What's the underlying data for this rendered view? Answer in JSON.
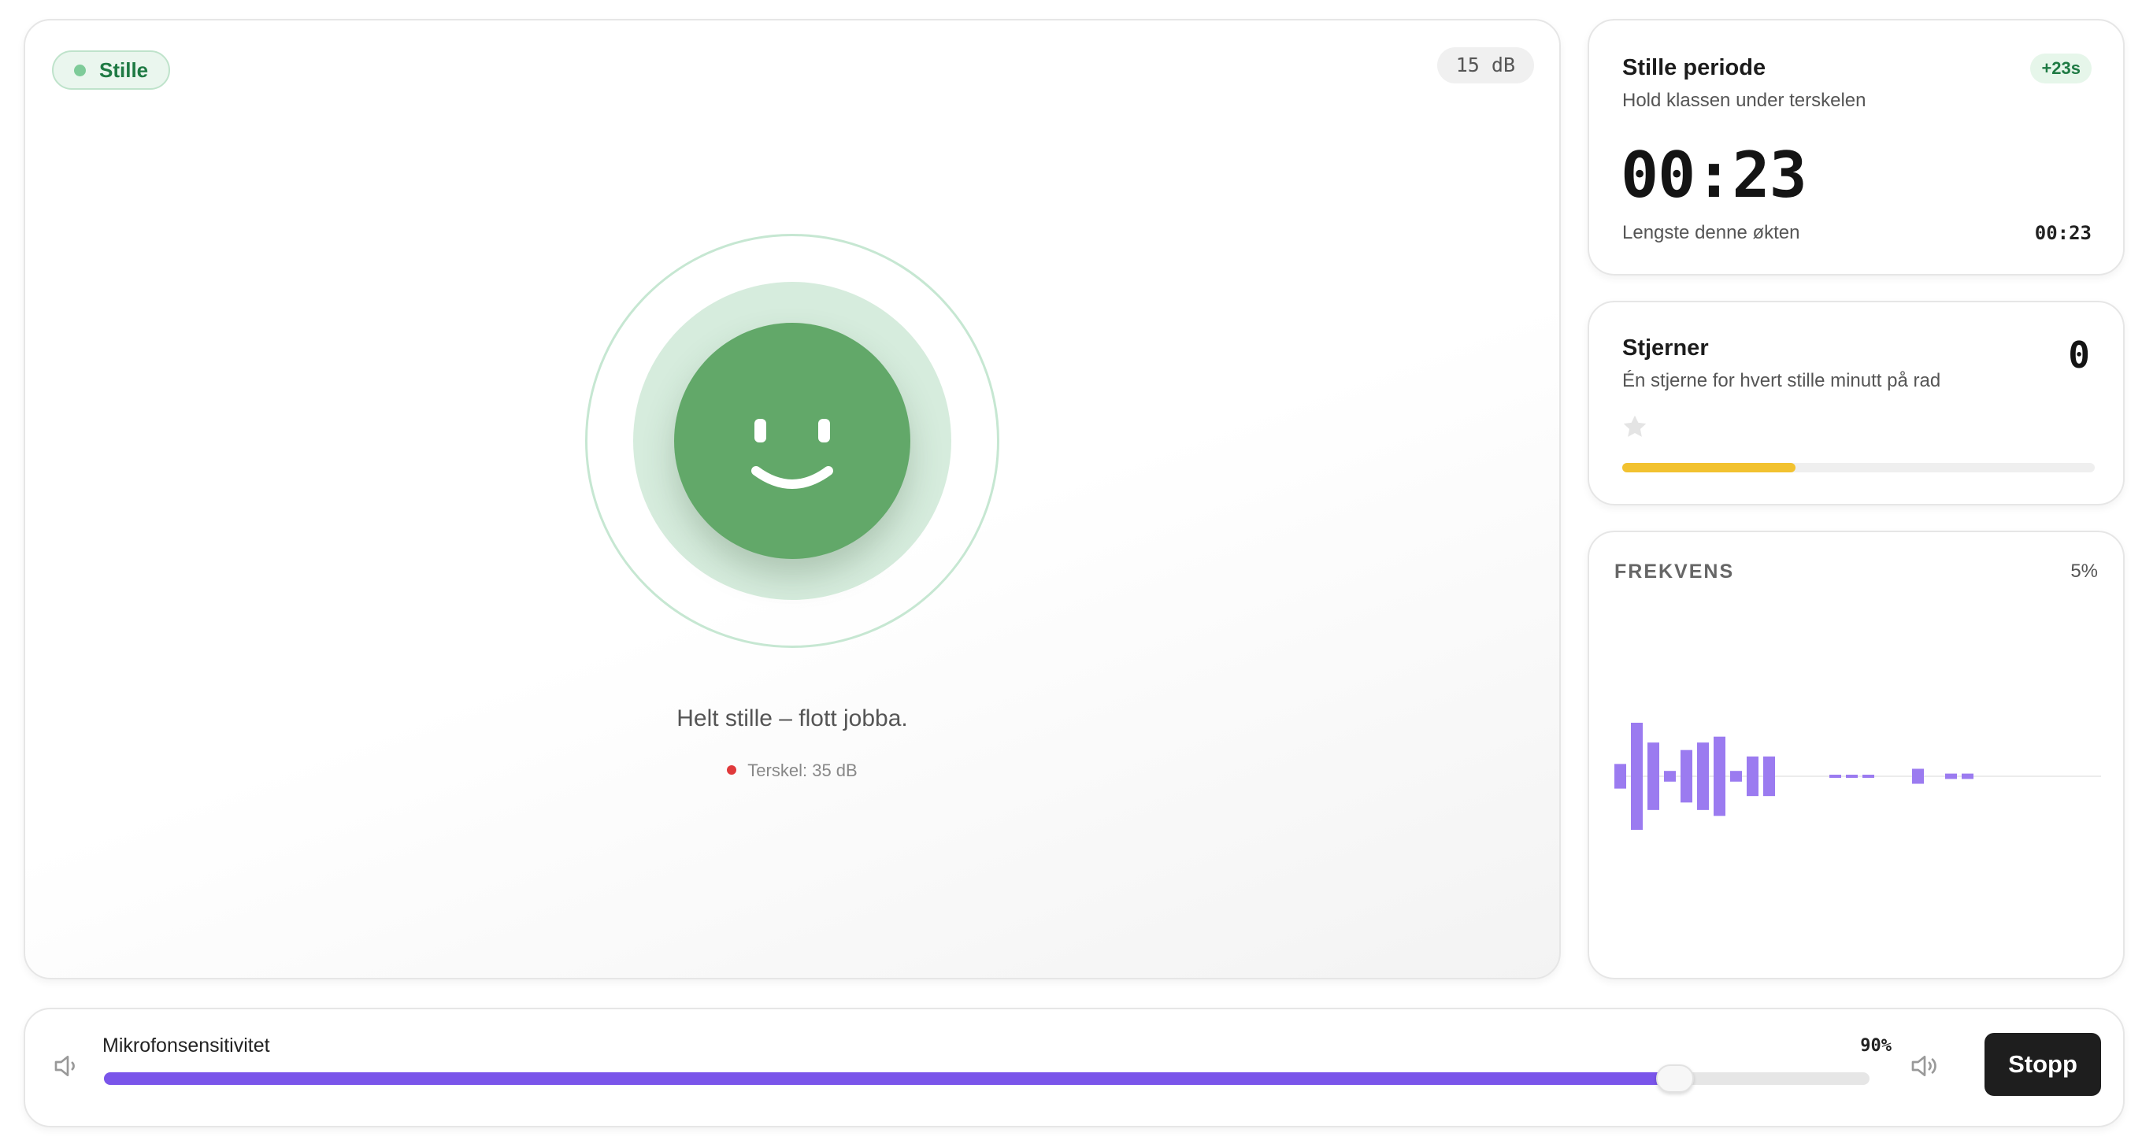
{
  "status": {
    "label": "Stille",
    "dot_color": "#7ecb99"
  },
  "level": {
    "db": "15 dB"
  },
  "face": {
    "mood": "smiley-face",
    "color": "#62a869"
  },
  "message": "Helt stille – flott jobba.",
  "threshold": {
    "label": "Terskel: 35 dB",
    "dot_color": "#e0393b"
  },
  "quiet_period": {
    "title": "Stille periode",
    "subtitle": "Hold klassen under terskelen",
    "delta": "+23s",
    "timer": "00:23",
    "longest_label": "Lengste denne økten",
    "longest_value": "00:23"
  },
  "stars": {
    "title": "Stjerner",
    "subtitle": "Én stjerne for hvert stille minutt på rad",
    "count": "0",
    "icon": "star-icon",
    "progress_fraction": 0.367,
    "progress_color": "#f2c230"
  },
  "frequency": {
    "title": "FREKVENS",
    "percent": "5%",
    "bar_color": "#9b7bf0",
    "bars": [
      {
        "index": 0,
        "amp": 0.23
      },
      {
        "index": 1,
        "amp": 1.0
      },
      {
        "index": 2,
        "amp": 0.63
      },
      {
        "index": 3,
        "amp": 0.1
      },
      {
        "index": 4,
        "amp": 0.49
      },
      {
        "index": 5,
        "amp": 0.63
      },
      {
        "index": 6,
        "amp": 0.74
      },
      {
        "index": 7,
        "amp": 0.1
      },
      {
        "index": 8,
        "amp": 0.37
      },
      {
        "index": 9,
        "amp": 0.37
      },
      {
        "index": 13,
        "amp": 0.02
      },
      {
        "index": 14,
        "amp": 0.02
      },
      {
        "index": 15,
        "amp": 0.02
      },
      {
        "index": 18,
        "amp": 0.14
      },
      {
        "index": 20,
        "amp": 0.05
      },
      {
        "index": 21,
        "amp": 0.05
      }
    ]
  },
  "controls": {
    "sensitivity_label": "Mikrofonsensitivitet",
    "sensitivity_value": "90%",
    "sensitivity_fraction": 0.89,
    "slider_color": "#7a55ea",
    "volume_low_icon": "volume-low-icon",
    "volume_high_icon": "volume-high-icon",
    "stop_label": "Stopp"
  }
}
